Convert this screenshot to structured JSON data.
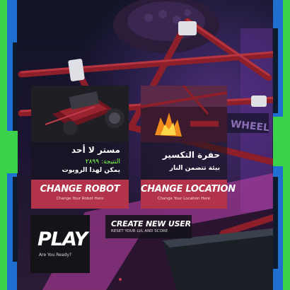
{
  "robot_card": {
    "name": "مستر لا أحد",
    "score_line": "النتيجة: ٢٨٩٩",
    "usable_line": "يمكن لهذا الروبوت",
    "button_label": "CHANGE ROBOT",
    "button_sub": "Change Your Robot Here"
  },
  "location_card": {
    "name": "حفرة التكسير",
    "description": "بيئة تتضمن النار",
    "button_label": "CHANGE LOCATION",
    "button_sub": "Change Your Location Here"
  },
  "play": {
    "label": "PLAY",
    "sub": "Are You Ready?"
  },
  "new_user": {
    "label": "CREATE NEW USER",
    "sub": "RESET YOUR LVL AND SCORE"
  },
  "arena_sign": "WHEEL",
  "colors": {
    "accent_red": "#b3334a",
    "edge_green": "#39d24a",
    "edge_blue": "#1f6fd1",
    "score_green": "#7CFF4E"
  }
}
